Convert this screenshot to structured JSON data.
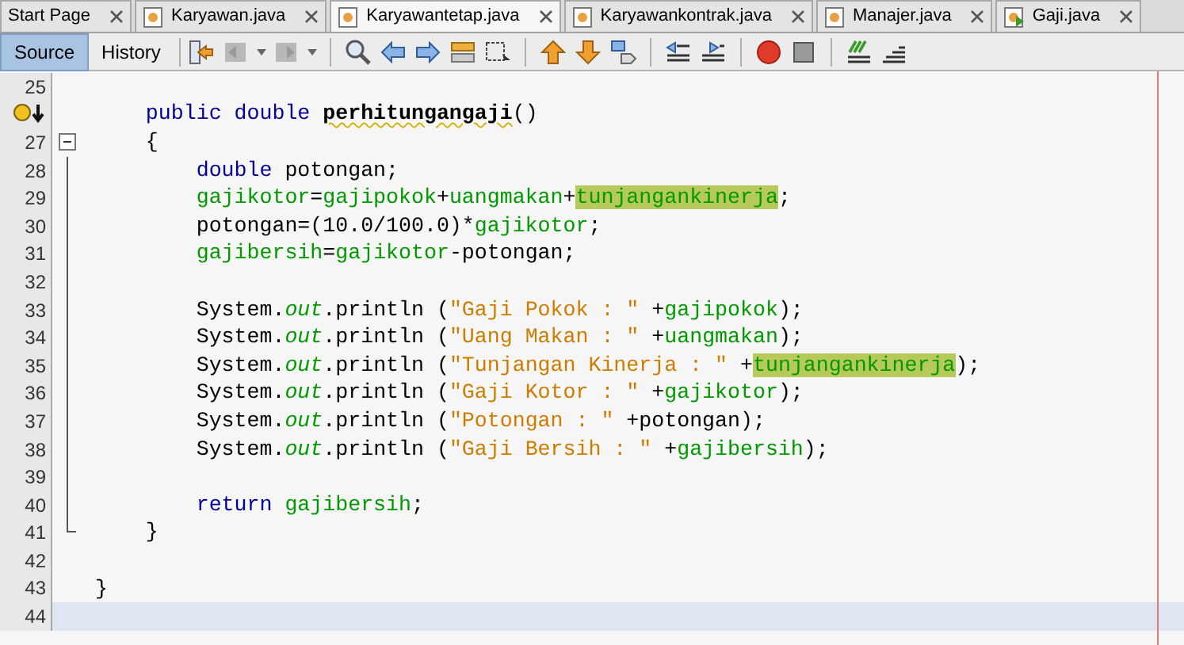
{
  "tabs": [
    {
      "label": "Start Page",
      "kind": "page",
      "selected": false
    },
    {
      "label": "Karyawan.java",
      "kind": "file",
      "selected": false
    },
    {
      "label": "Karyawantetap.java",
      "kind": "file",
      "selected": true
    },
    {
      "label": "Karyawankontrak.java",
      "kind": "file",
      "selected": false
    },
    {
      "label": "Manajer.java",
      "kind": "file",
      "selected": false
    },
    {
      "label": "Gaji.java",
      "kind": "main",
      "selected": false
    }
  ],
  "views": [
    {
      "label": "Source",
      "selected": true
    },
    {
      "label": "History",
      "selected": false
    }
  ],
  "lines": [
    {
      "number": "25",
      "kind": "plain"
    },
    {
      "kind": "hint",
      "tokens": [
        {
          "t": "    public double ",
          "kind": "keyword"
        },
        {
          "t": "perhitungangaji",
          "kind": "method"
        },
        {
          "t": "()",
          "kind": "plain"
        }
      ]
    },
    {
      "number": "27",
      "kind": "fold_start",
      "tokens": [
        {
          "t": "    {",
          "kind": "plain"
        }
      ]
    },
    {
      "number": "28",
      "kind": "fold_body",
      "tokens": [
        {
          "t": "        double ",
          "kind": "keyword"
        },
        {
          "t": "potongan;",
          "kind": "plain"
        }
      ]
    },
    {
      "number": "29",
      "kind": "fold_body",
      "tokens": [
        {
          "t": "        gajikotor",
          "kind": "field"
        },
        {
          "t": "=",
          "kind": "plain"
        },
        {
          "t": "gajipokok",
          "kind": "field"
        },
        {
          "t": "+",
          "kind": "plain"
        },
        {
          "t": "uangmakan",
          "kind": "field"
        },
        {
          "t": "+",
          "kind": "plain"
        },
        {
          "t": "tunjangankinerja",
          "kind": "marked"
        },
        {
          "t": ";",
          "kind": "plain"
        }
      ]
    },
    {
      "number": "30",
      "kind": "fold_body",
      "tokens": [
        {
          "t": "        potongan=(10.0/100.0)*",
          "kind": "plain"
        },
        {
          "t": "gajikotor",
          "kind": "field"
        },
        {
          "t": ";",
          "kind": "plain"
        }
      ]
    },
    {
      "number": "31",
      "kind": "fold_body",
      "tokens": [
        {
          "t": "        gajibersih",
          "kind": "field"
        },
        {
          "t": "=",
          "kind": "plain"
        },
        {
          "t": "gajikotor",
          "kind": "field"
        },
        {
          "t": "-potongan;",
          "kind": "plain"
        }
      ]
    },
    {
      "number": "32",
      "kind": "fold_body"
    },
    {
      "number": "33",
      "kind": "fold_body",
      "tokens": [
        {
          "t": "        System.",
          "kind": "plain"
        },
        {
          "t": "out",
          "kind": "static"
        },
        {
          "t": ".println (",
          "kind": "plain"
        },
        {
          "t": "\"Gaji Pokok : \"",
          "kind": "string"
        },
        {
          "t": " +",
          "kind": "plain"
        },
        {
          "t": "gajipokok",
          "kind": "field"
        },
        {
          "t": ");",
          "kind": "plain"
        }
      ]
    },
    {
      "number": "34",
      "kind": "fold_body",
      "tokens": [
        {
          "t": "        System.",
          "kind": "plain"
        },
        {
          "t": "out",
          "kind": "static"
        },
        {
          "t": ".println (",
          "kind": "plain"
        },
        {
          "t": "\"Uang Makan : \"",
          "kind": "string"
        },
        {
          "t": " +",
          "kind": "plain"
        },
        {
          "t": "uangmakan",
          "kind": "field"
        },
        {
          "t": ");",
          "kind": "plain"
        }
      ]
    },
    {
      "number": "35",
      "kind": "fold_body",
      "tokens": [
        {
          "t": "        System.",
          "kind": "plain"
        },
        {
          "t": "out",
          "kind": "static"
        },
        {
          "t": ".println (",
          "kind": "plain"
        },
        {
          "t": "\"Tunjangan Kinerja : \"",
          "kind": "string"
        },
        {
          "t": " +",
          "kind": "plain"
        },
        {
          "t": "tunjangankinerja",
          "kind": "marked"
        },
        {
          "t": ");",
          "kind": "plain"
        }
      ]
    },
    {
      "number": "36",
      "kind": "fold_body",
      "tokens": [
        {
          "t": "        System.",
          "kind": "plain"
        },
        {
          "t": "out",
          "kind": "static"
        },
        {
          "t": ".println (",
          "kind": "plain"
        },
        {
          "t": "\"Gaji Kotor : \"",
          "kind": "string"
        },
        {
          "t": " +",
          "kind": "plain"
        },
        {
          "t": "gajikotor",
          "kind": "field"
        },
        {
          "t": ");",
          "kind": "plain"
        }
      ]
    },
    {
      "number": "37",
      "kind": "fold_body",
      "tokens": [
        {
          "t": "        System.",
          "kind": "plain"
        },
        {
          "t": "out",
          "kind": "static"
        },
        {
          "t": ".println (",
          "kind": "plain"
        },
        {
          "t": "\"Potongan : \"",
          "kind": "string"
        },
        {
          "t": " +potongan);",
          "kind": "plain"
        }
      ]
    },
    {
      "number": "38",
      "kind": "fold_body",
      "tokens": [
        {
          "t": "        System.",
          "kind": "plain"
        },
        {
          "t": "out",
          "kind": "static"
        },
        {
          "t": ".println (",
          "kind": "plain"
        },
        {
          "t": "\"Gaji Bersih : \"",
          "kind": "string"
        },
        {
          "t": " +",
          "kind": "plain"
        },
        {
          "t": "gajibersih",
          "kind": "field"
        },
        {
          "t": ");",
          "kind": "plain"
        }
      ]
    },
    {
      "number": "39",
      "kind": "fold_body"
    },
    {
      "number": "40",
      "kind": "fold_body",
      "tokens": [
        {
          "t": "        return ",
          "kind": "keyword"
        },
        {
          "t": "gajibersih",
          "kind": "field"
        },
        {
          "t": ";",
          "kind": "plain"
        }
      ]
    },
    {
      "number": "41",
      "kind": "fold_end",
      "tokens": [
        {
          "t": "    }",
          "kind": "plain"
        }
      ]
    },
    {
      "number": "42",
      "kind": "plain"
    },
    {
      "number": "43",
      "kind": "plain",
      "tokens": [
        {
          "t": "}",
          "kind": "plain"
        }
      ]
    },
    {
      "number": "44",
      "kind": "plain",
      "current": true
    }
  ]
}
